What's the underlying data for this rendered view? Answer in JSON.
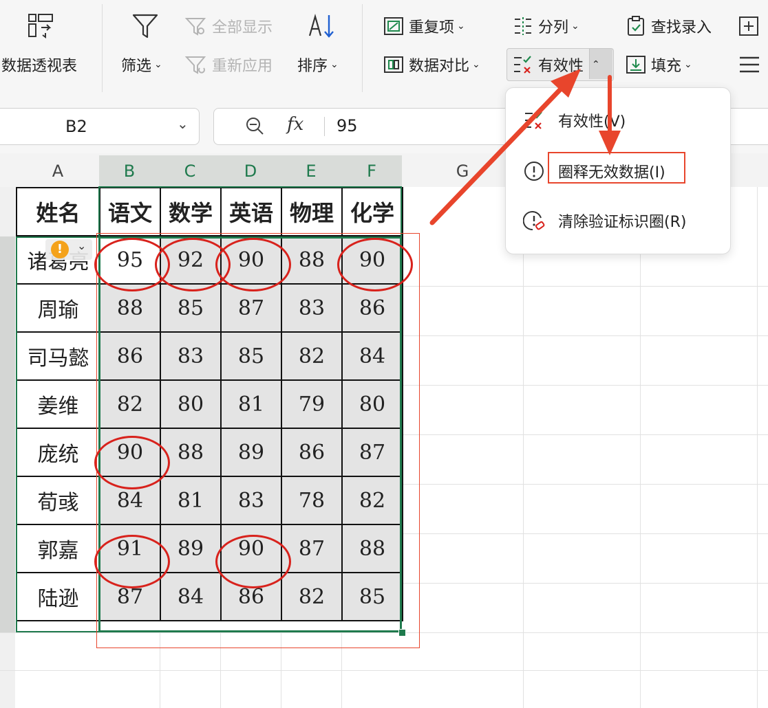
{
  "ribbon": {
    "pivot_label": "数据透视表",
    "filter_label": "筛选",
    "show_all_label": "全部显示",
    "reapply_label": "重新应用",
    "sort_label": "排序",
    "duplicates_label": "重复项",
    "compare_label": "数据对比",
    "split_label": "分列",
    "validity_label": "有效性",
    "find_entry_label": "查找录入",
    "fill_label": "填充"
  },
  "formula_bar": {
    "cell_ref": "B2",
    "value": "95",
    "fx_label": "fx"
  },
  "columns": [
    "A",
    "B",
    "C",
    "D",
    "E",
    "F",
    "G"
  ],
  "table": {
    "headers": [
      "姓名",
      "语文",
      "数学",
      "英语",
      "物理",
      "化学"
    ],
    "rows": [
      {
        "name": "诸葛亮",
        "scores": [
          "95",
          "92",
          "90",
          "88",
          "90"
        ]
      },
      {
        "name": "周瑜",
        "scores": [
          "88",
          "85",
          "87",
          "83",
          "86"
        ]
      },
      {
        "name": "司马懿",
        "scores": [
          "86",
          "83",
          "85",
          "82",
          "84"
        ]
      },
      {
        "name": "姜维",
        "scores": [
          "82",
          "80",
          "81",
          "79",
          "80"
        ]
      },
      {
        "name": "庞统",
        "scores": [
          "90",
          "88",
          "89",
          "86",
          "87"
        ]
      },
      {
        "name": "荀彧",
        "scores": [
          "84",
          "81",
          "83",
          "78",
          "82"
        ]
      },
      {
        "name": "郭嘉",
        "scores": [
          "91",
          "89",
          "90",
          "87",
          "88"
        ]
      },
      {
        "name": "陆逊",
        "scores": [
          "87",
          "84",
          "86",
          "82",
          "85"
        ]
      }
    ]
  },
  "dropdown_menu": {
    "items": [
      {
        "label": "有效性(V)"
      },
      {
        "label": "圈释无效数据(I)"
      },
      {
        "label": "清除验证标识圈(R)"
      }
    ]
  },
  "colors": {
    "accent_red": "#e8452c",
    "circle_red": "#d8221c",
    "selection_green": "#1f7a4d"
  }
}
